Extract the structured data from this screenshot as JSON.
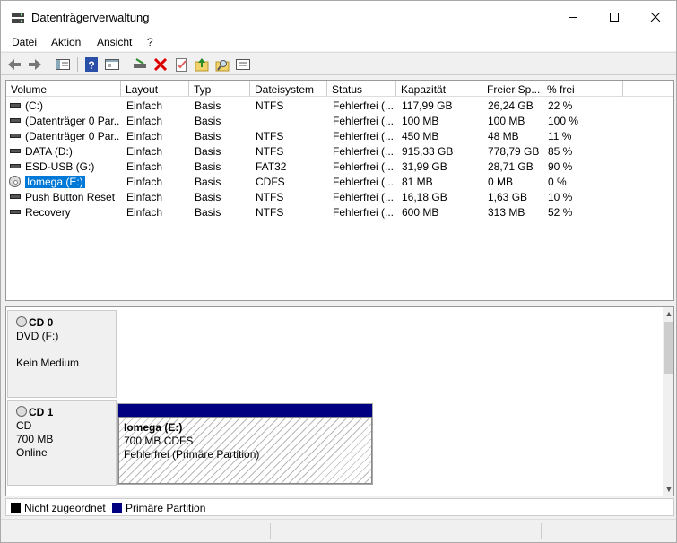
{
  "window": {
    "title": "Datenträgerverwaltung",
    "minimize_icon": "minimize-icon",
    "maximize_icon": "maximize-icon",
    "close_icon": "close-icon"
  },
  "menu": [
    "Datei",
    "Aktion",
    "Ansicht",
    "?"
  ],
  "toolbar": [
    "back-arrow-icon",
    "forward-arrow-icon",
    "console-tree-icon",
    "help-icon",
    "properties-icon",
    "connect-disk-icon",
    "delete-icon",
    "checklist-icon",
    "up-folder-icon",
    "search-folder-icon",
    "list-view-icon"
  ],
  "columns": [
    "Volume",
    "Layout",
    "Typ",
    "Dateisystem",
    "Status",
    "Kapazität",
    "Freier Sp...",
    "% frei"
  ],
  "volumes": [
    {
      "icon": "drive",
      "name": "(C:)",
      "layout": "Einfach",
      "typ": "Basis",
      "fs": "NTFS",
      "status": "Fehlerfrei (...",
      "cap": "117,99 GB",
      "free": "26,24 GB",
      "pct": "22 %"
    },
    {
      "icon": "drive",
      "name": "(Datenträger 0 Par...",
      "layout": "Einfach",
      "typ": "Basis",
      "fs": "",
      "status": "Fehlerfrei (...",
      "cap": "100 MB",
      "free": "100 MB",
      "pct": "100 %"
    },
    {
      "icon": "drive",
      "name": "(Datenträger 0 Par...",
      "layout": "Einfach",
      "typ": "Basis",
      "fs": "NTFS",
      "status": "Fehlerfrei (...",
      "cap": "450 MB",
      "free": "48 MB",
      "pct": "11 %"
    },
    {
      "icon": "drive",
      "name": "DATA (D:)",
      "layout": "Einfach",
      "typ": "Basis",
      "fs": "NTFS",
      "status": "Fehlerfrei (...",
      "cap": "915,33 GB",
      "free": "778,79 GB",
      "pct": "85 %"
    },
    {
      "icon": "drive",
      "name": "ESD-USB (G:)",
      "layout": "Einfach",
      "typ": "Basis",
      "fs": "FAT32",
      "status": "Fehlerfrei (...",
      "cap": "31,99 GB",
      "free": "28,71 GB",
      "pct": "90 %"
    },
    {
      "icon": "cd",
      "name": "Iomega (E:)",
      "layout": "Einfach",
      "typ": "Basis",
      "fs": "CDFS",
      "status": "Fehlerfrei (...",
      "cap": "81 MB",
      "free": "0 MB",
      "pct": "0 %",
      "selected": true
    },
    {
      "icon": "drive",
      "name": "Push Button Reset",
      "layout": "Einfach",
      "typ": "Basis",
      "fs": "NTFS",
      "status": "Fehlerfrei (...",
      "cap": "16,18 GB",
      "free": "1,63 GB",
      "pct": "10 %"
    },
    {
      "icon": "drive",
      "name": "Recovery",
      "layout": "Einfach",
      "typ": "Basis",
      "fs": "NTFS",
      "status": "Fehlerfrei (...",
      "cap": "600 MB",
      "free": "313 MB",
      "pct": "52 %"
    }
  ],
  "disks": [
    {
      "name": "CD 0",
      "line1": "DVD (F:)",
      "line2": "",
      "line3": "Kein Medium"
    },
    {
      "name": "CD 1",
      "line1": "CD",
      "line2": "700 MB",
      "line3": "Online"
    }
  ],
  "partition": {
    "name": "Iomega  (E:)",
    "size": "700 MB CDFS",
    "status": "Fehlerfrei (Primäre Partition)"
  },
  "legend": [
    {
      "label": "Nicht zugeordnet",
      "color": "#000000"
    },
    {
      "label": "Primäre Partition",
      "color": "#000080"
    }
  ],
  "colors": {
    "selection": "#0078d7",
    "primary_partition": "#000080",
    "unallocated": "#000000"
  }
}
